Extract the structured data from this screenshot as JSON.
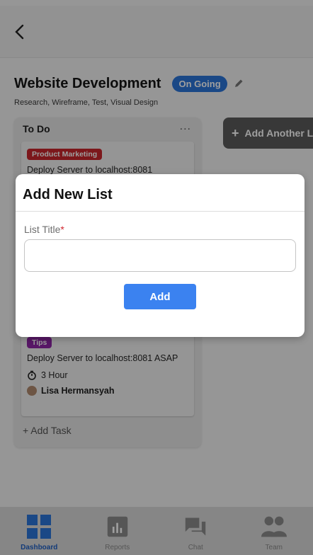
{
  "header": {
    "back_icon": "chevron-left-icon"
  },
  "project": {
    "title": "Website Development",
    "status": "On Going",
    "subtitle": "Research, Wireframe, Test, Visual Design"
  },
  "column": {
    "title": "To Do",
    "more": "...",
    "cards": [
      {
        "tag": "Product Marketing",
        "text": "Deploy Server to localhost:8081"
      },
      {
        "tag": "Tips",
        "text": "Deploy Server to localhost:8081 ASAP",
        "time": "3 Hour",
        "assignee": "Lisa Hermansyah"
      }
    ],
    "add_task": "+ Add Task"
  },
  "add_another": {
    "plus": "+",
    "label": "Add Another List"
  },
  "modal": {
    "title": "Add New List",
    "field_label": "List Title",
    "required_mark": "*",
    "input_value": "",
    "add_label": "Add"
  },
  "nav": [
    {
      "label": "Dashboard",
      "icon": "dashboard-grid-icon",
      "active": true
    },
    {
      "label": "Reports",
      "icon": "bar-chart-icon",
      "active": false
    },
    {
      "label": "Chat",
      "icon": "chat-bubble-icon",
      "active": false
    },
    {
      "label": "Team",
      "icon": "people-icon",
      "active": false
    }
  ],
  "colors": {
    "accent": "#3b82f0",
    "status_badge": "#2a74d8",
    "tag_marketing": "#c8262d",
    "tag_tips": "#8e26a6",
    "nav_active": "#1f5fc4"
  }
}
